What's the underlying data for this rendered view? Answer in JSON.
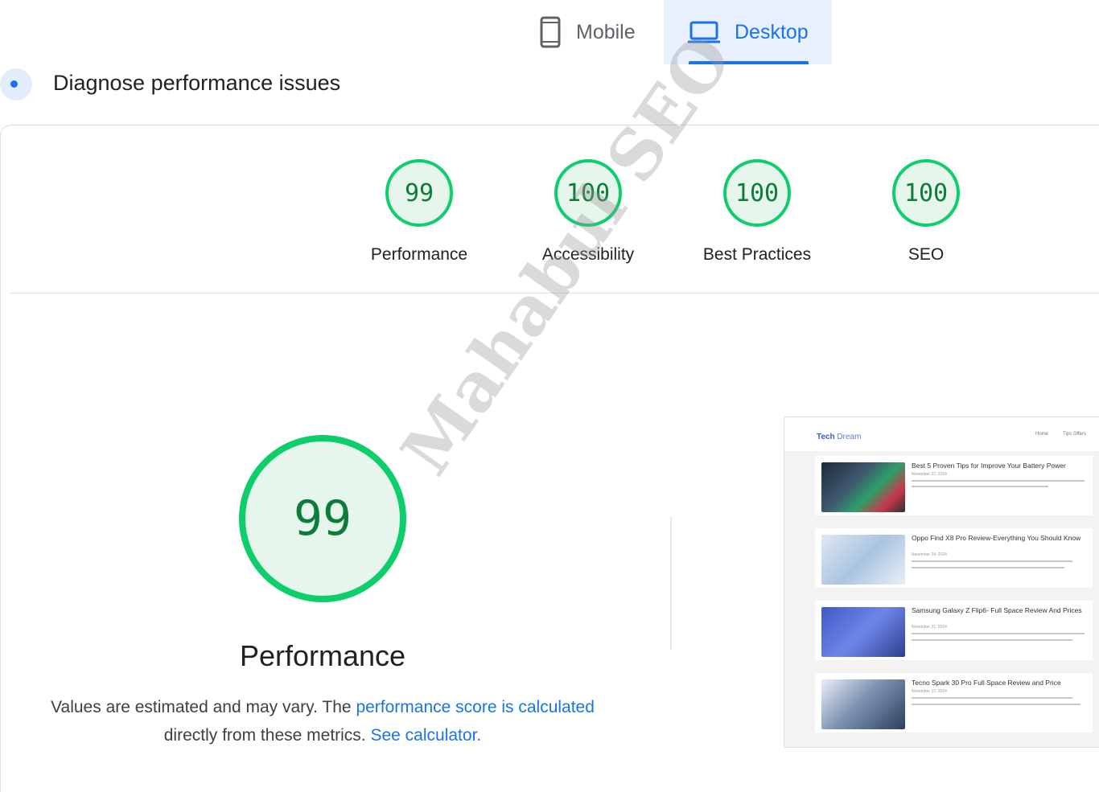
{
  "tabs": {
    "mobile_label": "Mobile",
    "desktop_label": "Desktop",
    "selected": "Desktop"
  },
  "header": {
    "title": "Diagnose performance issues"
  },
  "scores": [
    {
      "value": "99",
      "label": "Performance"
    },
    {
      "value": "100",
      "label": "Accessibility"
    },
    {
      "value": "100",
      "label": "Best Practices"
    },
    {
      "value": "100",
      "label": "SEO"
    }
  ],
  "performance": {
    "score": "99",
    "title": "Performance",
    "desc_prefix": "Values are estimated and may vary. The ",
    "desc_link1": "performance score is calculated",
    "desc_middle": " directly from these metrics. ",
    "desc_link2": "See calculator.",
    "desc_suffix": ""
  },
  "watermark": "Mahabul SEO",
  "screenshot": {
    "brand": "Tech",
    "brand_suffix": " Dream",
    "nav": [
      "Home",
      "Tips Offers"
    ],
    "posts": [
      {
        "title": "Best 5 Proven Tips for Improve Your Battery Power",
        "date": "November 27, 2024"
      },
      {
        "title": "Oppo Find X8 Pro Review-Everything You Should Know",
        "date": "November 24, 2024"
      },
      {
        "title": "Samsung Galaxy Z Flip6- Full Space Review And Prices",
        "date": "November 21, 2024"
      },
      {
        "title": "Tecno Spark 30 Pro Full Space Review and Price",
        "date": "November 17, 2024"
      }
    ]
  },
  "colors": {
    "pass_green": "#0cce6b",
    "score_text": "#0b7d39",
    "accent_blue": "#1a73e8"
  }
}
